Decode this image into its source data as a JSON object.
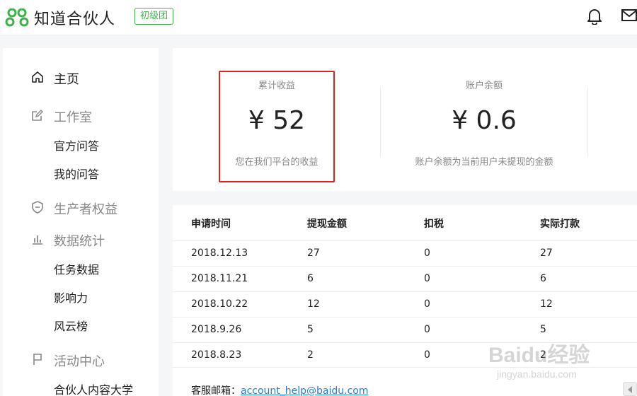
{
  "header": {
    "logo_text": "知道合伙人",
    "tag": "初级团"
  },
  "sidebar": {
    "items": [
      {
        "label": "主页",
        "icon": "home-icon",
        "active": true
      },
      {
        "label": "工作室",
        "icon": "edit-icon",
        "sub": [
          "官方问答",
          "我的问答"
        ]
      },
      {
        "label": "生产者权益",
        "icon": "shield-icon"
      },
      {
        "label": "数据统计",
        "icon": "bar-chart-icon",
        "sub": [
          "任务数据",
          "影响力",
          "风云榜"
        ]
      },
      {
        "label": "活动中心",
        "icon": "flag-icon",
        "sub": [
          "合伙人内容大学"
        ]
      }
    ]
  },
  "stats": [
    {
      "title": "累计收益",
      "value": "¥ 52",
      "desc": "您在我们平台的收益"
    },
    {
      "title": "账户余额",
      "value": "¥ 0.6",
      "desc": "账户余额为当前用户未提现的金额"
    }
  ],
  "table": {
    "headers": [
      "申请时间",
      "提现金额",
      "扣税",
      "实际打款"
    ],
    "rows": [
      [
        "2018.12.13",
        "27",
        "0",
        "27"
      ],
      [
        "2018.11.21",
        "6",
        "0",
        "6"
      ],
      [
        "2018.10.22",
        "12",
        "0",
        "12"
      ],
      [
        "2018.9.26",
        "5",
        "0",
        "5"
      ],
      [
        "2018.8.23",
        "2",
        "0",
        "2"
      ]
    ]
  },
  "footer": {
    "label": "客服邮箱：",
    "email": "account_help@baidu.com"
  },
  "watermark": {
    "text": "Baidu经验",
    "sub": "jingyan.baidu.com"
  },
  "colors": {
    "brand_green": "#3bb34a",
    "highlight_red": "#e32020",
    "link_blue": "#2b7bd6"
  }
}
